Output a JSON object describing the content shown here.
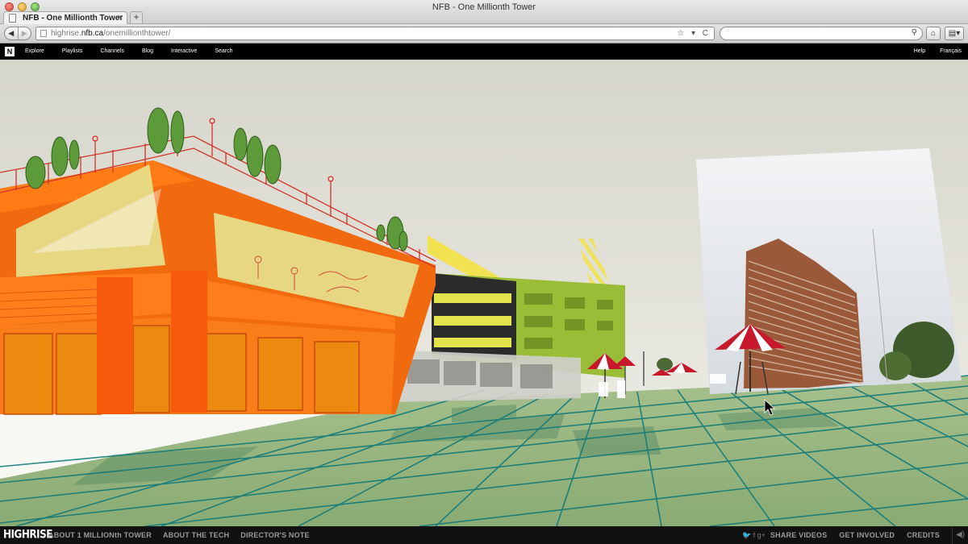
{
  "window": {
    "title": "NFB - One Millionth Tower",
    "tab_title": "NFB - One Millionth Tower",
    "tab_close": "×",
    "new_tab": "+"
  },
  "toolbar": {
    "back": "◀",
    "forward": "▶",
    "url_scheme_host": "highrise.",
    "url_domain": "nfb.ca",
    "url_path": "/onemillionthtower/",
    "url_icons": "☆ ▾ C",
    "search_icon": "🔍",
    "home": "⌂",
    "bookmarks": "▤▾"
  },
  "sitenav": {
    "logo": "N",
    "links": [
      "Explore",
      "Playlists",
      "Channels",
      "Blog",
      "Interactive",
      "Search"
    ],
    "right_links": [
      "Help",
      "Français"
    ]
  },
  "footer": {
    "logo": "HIGHRISE",
    "links": [
      "ABOUT 1 MILLIONth TOWER",
      "ABOUT THE TECH",
      "DIRECTOR'S NOTE"
    ],
    "social": "🐦 f g+",
    "right_links": [
      "SHARE VIDEOS",
      "GET INVOLVED",
      "CREDITS"
    ],
    "sound": "◀)"
  },
  "colors": {
    "accent_orange": "#f26a10",
    "grid_teal": "#127a78",
    "ground_green": "#8fb07a",
    "umbrella_red": "#c8182c"
  }
}
